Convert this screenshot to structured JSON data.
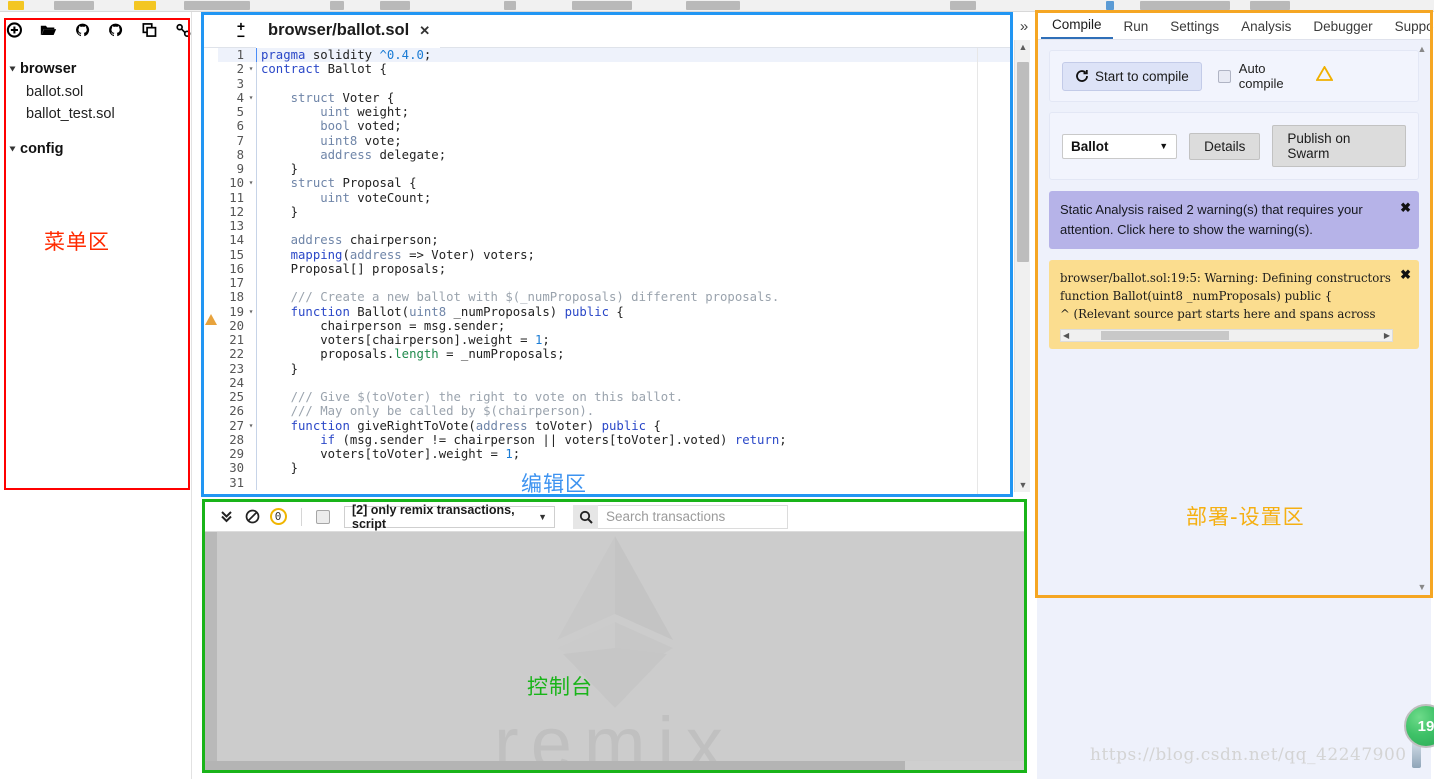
{
  "explorer": {
    "toolbar_icons": [
      {
        "name": "create-file-icon",
        "title": "Create new file"
      },
      {
        "name": "open-folder-icon",
        "title": "Open local file"
      },
      {
        "name": "publish-gist-icon",
        "title": "Publish to gist"
      },
      {
        "name": "copy-gist-icon",
        "title": "Copy gist"
      },
      {
        "name": "copy-files-icon",
        "title": "Copy files"
      },
      {
        "name": "connect-localhost-icon",
        "title": "Connect to localhost"
      }
    ],
    "tree": [
      {
        "label": "browser",
        "type": "folder",
        "expanded": true
      },
      {
        "label": "ballot.sol",
        "type": "file"
      },
      {
        "label": "ballot_test.sol",
        "type": "file"
      },
      {
        "label": "config",
        "type": "folder",
        "expanded": true
      }
    ]
  },
  "annotations": {
    "menu_area": "菜单区",
    "editor_area": "编辑区",
    "terminal_area": "控制台",
    "deploy_area": "部署-设置区"
  },
  "editor": {
    "collapse_left_icon": "«",
    "collapse_right_icon": "»",
    "zoom_in": "+",
    "zoom_out": "−",
    "tab_title": "browser/ballot.sol",
    "tab_close": "✕",
    "lines": [
      {
        "n": "1",
        "fold": "",
        "html": "<span class=\"k\">pragma</span> <span class=\"p\">solidity</span> <span class=\"n\">^0.4.0</span><span class=\"p\">;</span>",
        "hl": true
      },
      {
        "n": "2",
        "fold": "▾",
        "html": "<span class=\"k\">contract</span> <span class=\"p\">Ballot {</span>"
      },
      {
        "n": "3",
        "fold": "",
        "html": ""
      },
      {
        "n": "4",
        "fold": "▾",
        "html": "    <span class=\"t\">struct</span> <span class=\"p\">Voter {</span>"
      },
      {
        "n": "5",
        "fold": "",
        "html": "        <span class=\"t\">uint</span> <span class=\"p\">weight;</span>"
      },
      {
        "n": "6",
        "fold": "",
        "html": "        <span class=\"t\">bool</span> <span class=\"p\">voted;</span>"
      },
      {
        "n": "7",
        "fold": "",
        "html": "        <span class=\"t\">uint8</span> <span class=\"p\">vote;</span>"
      },
      {
        "n": "8",
        "fold": "",
        "html": "        <span class=\"t\">address</span> <span class=\"p\">delegate;</span>"
      },
      {
        "n": "9",
        "fold": "",
        "html": "    <span class=\"p\">}</span>"
      },
      {
        "n": "10",
        "fold": "▾",
        "html": "    <span class=\"t\">struct</span> <span class=\"p\">Proposal {</span>"
      },
      {
        "n": "11",
        "fold": "",
        "html": "        <span class=\"t\">uint</span> <span class=\"p\">voteCount;</span>"
      },
      {
        "n": "12",
        "fold": "",
        "html": "    <span class=\"p\">}</span>"
      },
      {
        "n": "13",
        "fold": "",
        "html": ""
      },
      {
        "n": "14",
        "fold": "",
        "html": "    <span class=\"t\">address</span> <span class=\"p\">chairperson;</span>"
      },
      {
        "n": "15",
        "fold": "",
        "html": "    <span class=\"k\">mapping</span><span class=\"p\">(</span><span class=\"t\">address</span> <span class=\"p\">=&gt; Voter) voters;</span>"
      },
      {
        "n": "16",
        "fold": "",
        "html": "    <span class=\"p\">Proposal[] proposals;</span>"
      },
      {
        "n": "17",
        "fold": "",
        "html": ""
      },
      {
        "n": "18",
        "fold": "",
        "html": "    <span class=\"c\">/// Create a new ballot with $(_numProposals) different proposals.</span>"
      },
      {
        "n": "19",
        "fold": "▾",
        "html": "    <span class=\"k\">function</span> <span class=\"p\">Ballot(</span><span class=\"t\">uint8</span> <span class=\"p\">_numProposals)</span> <span class=\"k\">public</span> <span class=\"p\">{</span>"
      },
      {
        "n": "20",
        "fold": "",
        "html": "        <span class=\"p\">chairperson = msg.sender;</span>"
      },
      {
        "n": "21",
        "fold": "",
        "html": "        <span class=\"p\">voters[chairperson].weight = </span><span class=\"n\">1</span><span class=\"p\">;</span>"
      },
      {
        "n": "22",
        "fold": "",
        "html": "        <span class=\"p\">proposals.</span><span class=\"g\">length</span><span class=\"p\"> = _numProposals;</span>"
      },
      {
        "n": "23",
        "fold": "",
        "html": "    <span class=\"p\">}</span>"
      },
      {
        "n": "24",
        "fold": "",
        "html": ""
      },
      {
        "n": "25",
        "fold": "",
        "html": "    <span class=\"c\">/// Give $(toVoter) the right to vote on this ballot.</span>"
      },
      {
        "n": "26",
        "fold": "",
        "html": "    <span class=\"c\">/// May only be called by $(chairperson).</span>"
      },
      {
        "n": "27",
        "fold": "▾",
        "html": "    <span class=\"k\">function</span> <span class=\"p\">giveRightToVote(</span><span class=\"t\">address</span> <span class=\"p\">toVoter)</span> <span class=\"k\">public</span> <span class=\"p\">{</span>"
      },
      {
        "n": "28",
        "fold": "",
        "html": "        <span class=\"k\">if</span> <span class=\"p\">(msg.sender != chairperson || voters[toVoter].voted)</span> <span class=\"k\">return</span><span class=\"p\">;</span>"
      },
      {
        "n": "29",
        "fold": "",
        "html": "        <span class=\"p\">voters[toVoter].weight = </span><span class=\"n\">1</span><span class=\"p\">;</span>"
      },
      {
        "n": "30",
        "fold": "",
        "html": "    <span class=\"p\">}</span>"
      },
      {
        "n": "31",
        "fold": "",
        "html": ""
      }
    ]
  },
  "terminal": {
    "toggle_icon": "⌄⌄",
    "clear_icon": "⊘",
    "pending_count": "0",
    "listen_checkbox_checked": false,
    "filter_value": "[2] only remix transactions, script",
    "search_placeholder": "Search transactions",
    "search_value": "",
    "watermark": "remix"
  },
  "compile_panel": {
    "tabs": [
      {
        "label": "Compile",
        "active": true
      },
      {
        "label": "Run",
        "active": false
      },
      {
        "label": "Settings",
        "active": false
      },
      {
        "label": "Analysis",
        "active": false
      },
      {
        "label": "Debugger",
        "active": false
      },
      {
        "label": "Support",
        "active": false
      }
    ],
    "start_compile_label": "Start to compile",
    "auto_compile_label": "Auto compile",
    "auto_compile_checked": false,
    "contract_selected": "Ballot",
    "details_label": "Details",
    "publish_label": "Publish on Swarm",
    "static_analysis_alert": "Static Analysis raised 2 warning(s) that requires your attention. Click here to show the warning(s).",
    "alert_close": "✖",
    "compiler_warning_lines": [
      "browser/ballot.sol:19:5: Warning: Defining constructors",
      "    function Ballot(uint8 _numProposals) public {",
      "  ^ (Relevant source part starts here and spans across"
    ]
  },
  "watermark": {
    "url": "https://blog.csdn.net/qq_42247900",
    "badge_number": "19"
  },
  "colors": {
    "accent_blue": "#2196f3",
    "anno_red": "#ff0000",
    "anno_green": "#19b419",
    "anno_amber": "#f5a623",
    "warn_yellow": "#fbdd8f",
    "alert_purple": "#b6b3e8"
  }
}
